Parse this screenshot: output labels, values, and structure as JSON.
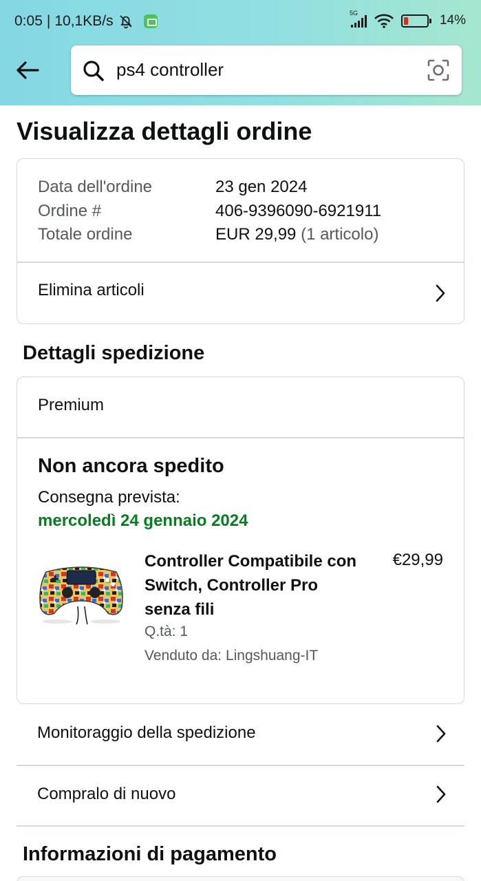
{
  "status_bar": {
    "time": "0:05",
    "separator": "|",
    "speed": "10,1KB/s",
    "network": "5G",
    "battery": "14%"
  },
  "search": {
    "query": "ps4 controller"
  },
  "page": {
    "title": "Visualizza dettagli ordine"
  },
  "order_summary": {
    "date_label": "Data dell'ordine",
    "date_value": "23 gen 2024",
    "number_label": "Ordine #",
    "number_value": "406-9396090-6921911",
    "total_label": "Totale ordine",
    "total_value": "EUR 29,99",
    "total_items": "(1 articolo)",
    "delete_items": "Elimina articoli"
  },
  "shipping": {
    "section_title": "Dettagli spedizione",
    "service": "Premium",
    "status": "Non ancora spedito",
    "delivery_label": "Consegna prevista:",
    "delivery_date": "mercoledì 24 gennaio 2024",
    "product": {
      "title": "Controller Compatibile con Switch, Controller Pro senza fili",
      "price": "€29,99",
      "quantity": "Q.tà: 1",
      "seller": "Venduto da: Lingshuang-IT"
    }
  },
  "actions": {
    "track": "Monitoraggio della spedizione",
    "buy_again": "Compralo di nuovo"
  },
  "payment": {
    "section_title": "Informazioni di pagamento"
  },
  "colors": {
    "header_start": "#84d8e3",
    "header_end": "#a5e6cf",
    "delivery_green": "#067d20",
    "border": "#d5d9d9"
  }
}
